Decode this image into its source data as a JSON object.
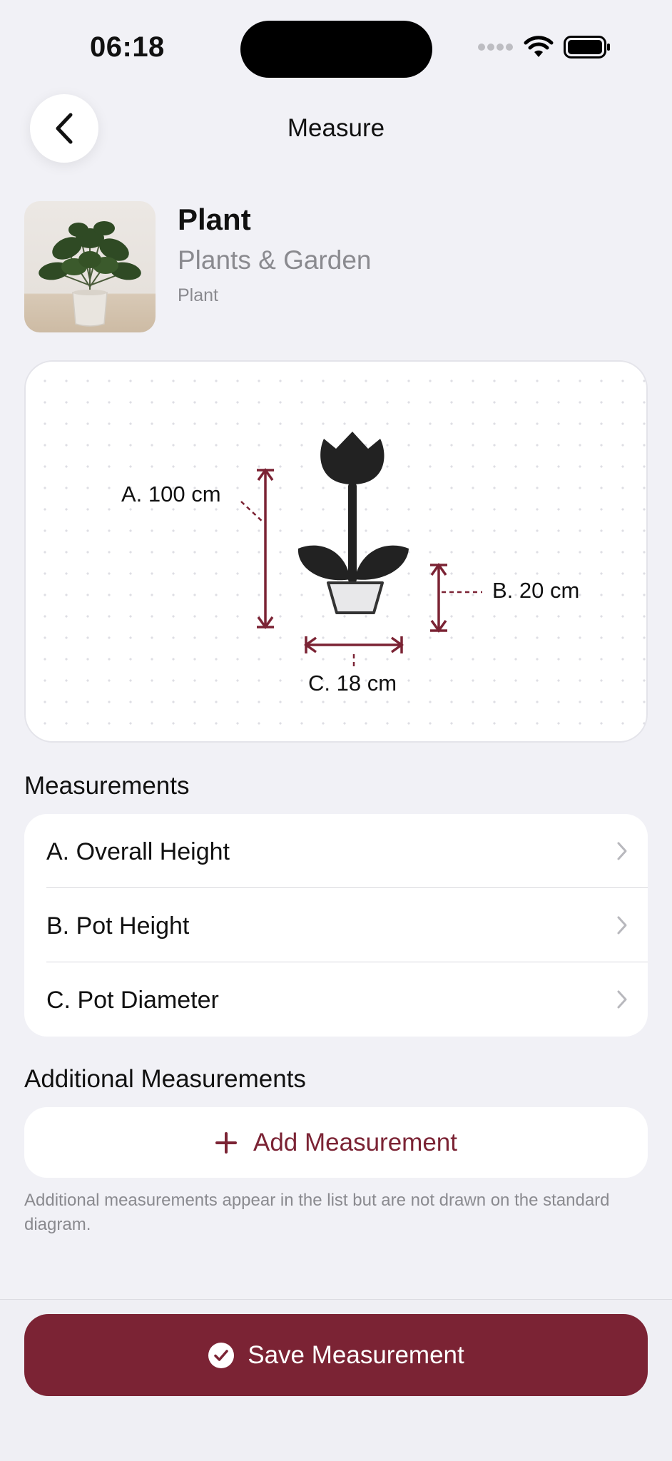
{
  "status_bar": {
    "time": "06:18",
    "icons": [
      "signal-dots-icon",
      "wifi-icon",
      "battery-icon"
    ]
  },
  "nav": {
    "title": "Measure",
    "back_icon": "chevron-left-icon"
  },
  "product": {
    "name": "Plant",
    "category": "Plants & Garden",
    "type": "Plant",
    "image": "potted-plant-photo"
  },
  "diagram": {
    "labels": {
      "a": "A. 100 cm",
      "b": "B. 20 cm",
      "c": "C. 18 cm"
    },
    "accent_color": "#7b2334"
  },
  "measurements": {
    "title": "Measurements",
    "items": [
      {
        "label": "A. Overall Height"
      },
      {
        "label": "B. Pot Height"
      },
      {
        "label": "C. Pot Diameter"
      }
    ]
  },
  "additional": {
    "title": "Additional Measurements",
    "add_label": "Add Measurement",
    "note": "Additional measurements appear in the list but are not drawn on the standard diagram."
  },
  "footer": {
    "save_label": "Save Measurement"
  },
  "colors": {
    "accent": "#7b2334",
    "background": "#f1f1f6",
    "secondary_text": "#8a8a8f"
  }
}
